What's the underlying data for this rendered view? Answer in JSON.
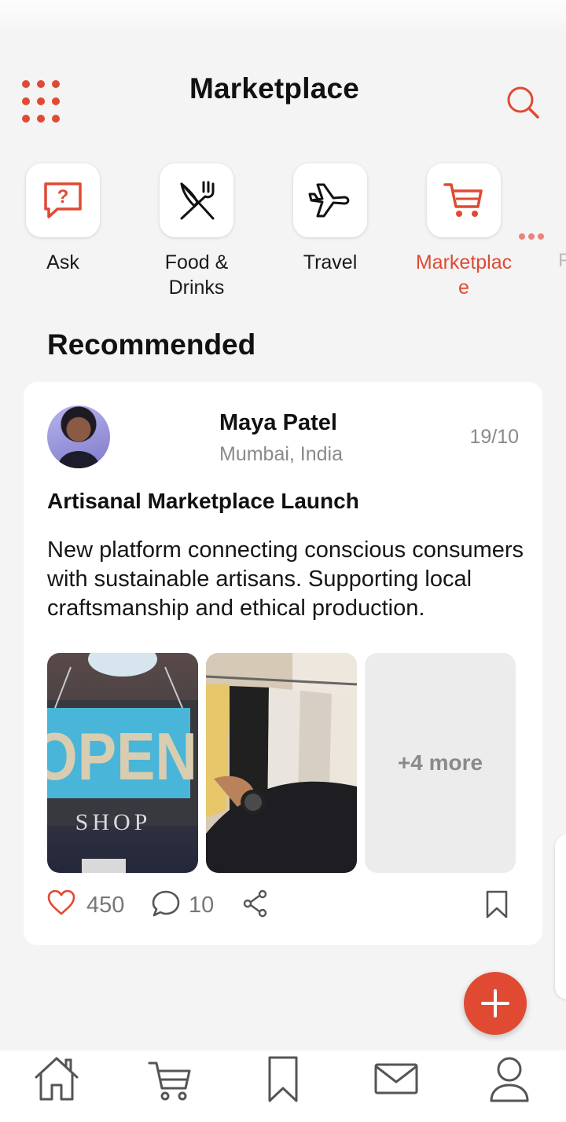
{
  "header": {
    "title": "Marketplace",
    "menu_icon": "grid-dots-icon",
    "search_icon": "search-icon"
  },
  "categories": [
    {
      "label": "Ask",
      "icon": "question-chat-icon",
      "active": false
    },
    {
      "label": "Food &\nDrinks",
      "icon": "fork-knife-icon",
      "active": false
    },
    {
      "label": "Travel",
      "icon": "airplane-icon",
      "active": false
    },
    {
      "label": "Marketplac\ne",
      "icon": "cart-icon",
      "active": true
    }
  ],
  "section_title": "Recommended",
  "post": {
    "author_name": "Maya Patel",
    "author_location": "Mumbai, India",
    "date": "19/10",
    "title": "Artisanal Marketplace Launch",
    "body": "New platform connecting conscious consumers with sustainable artisans. Supporting local craftsmanship and ethical production.",
    "image_1_sign_top": "OPEN",
    "image_1_sign_bottom": "SHOP",
    "more_images_label": "+4 more",
    "likes": "450",
    "comments": "10"
  },
  "bottom_nav": [
    "home-icon",
    "cart-icon",
    "bookmark-icon",
    "mail-icon",
    "profile-icon"
  ],
  "colors": {
    "accent": "#e04a33",
    "background": "#f4f4f4",
    "muted_text": "#8a8a8a"
  }
}
